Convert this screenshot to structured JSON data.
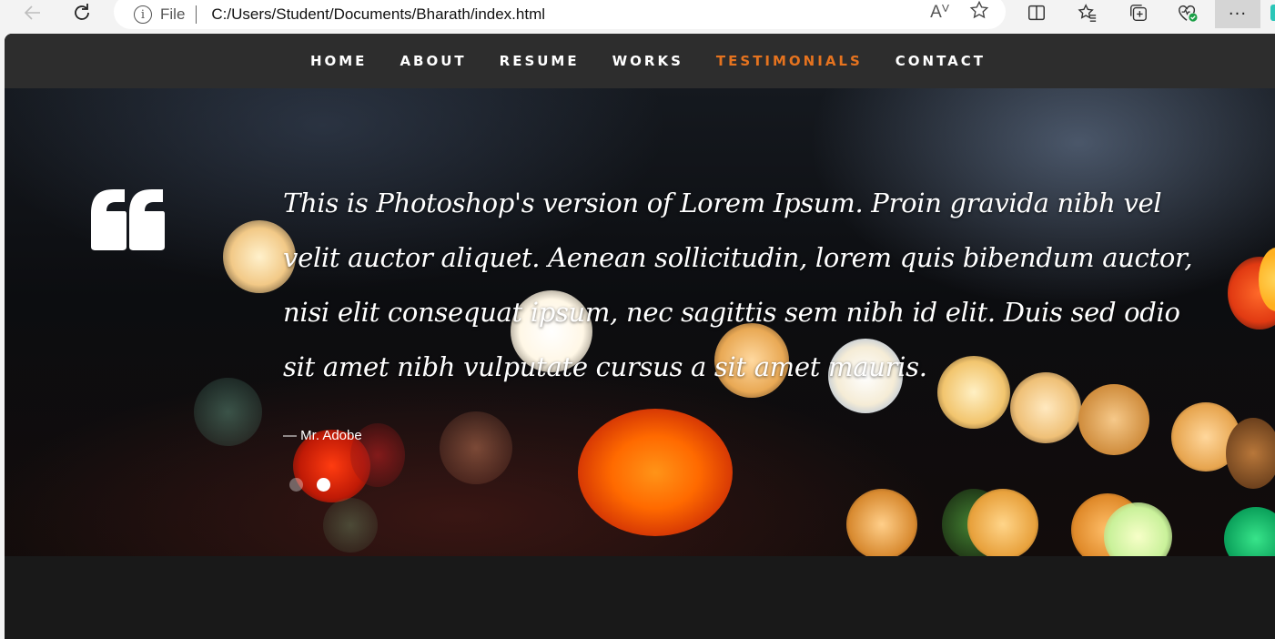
{
  "browser": {
    "address_scheme": "File",
    "url": "C:/Users/Student/Documents/Bharath/index.html",
    "read_aloud_glyph": "Aⱽ",
    "more_label": "···",
    "icons": [
      "back-icon",
      "refresh-icon",
      "info-icon",
      "read-aloud-icon",
      "favorite-star-icon",
      "split-screen-icon",
      "favorites-icon",
      "collections-icon",
      "browser-essentials-icon",
      "more-icon"
    ]
  },
  "nav": {
    "items": [
      {
        "label": "HOME"
      },
      {
        "label": "ABOUT"
      },
      {
        "label": "RESUME"
      },
      {
        "label": "WORKS"
      },
      {
        "label": "TESTIMONIALS"
      },
      {
        "label": "CONTACT"
      }
    ],
    "active": "TESTIMONIALS",
    "active_color": "#e5731f"
  },
  "testimonial": {
    "quote": "This is Photoshop's version of Lorem Ipsum. Proin gravida nibh vel velit auctor aliquet. Aenean sollicitudin, lorem quis bibendum auctor, nisi elit consequat ipsum, nec sagittis sem nibh id elit. Duis sed odio sit amet nibh vulputate cursus a sit amet mauris.",
    "author": "— Mr. Adobe",
    "slides": 2,
    "active_slide": 2
  }
}
